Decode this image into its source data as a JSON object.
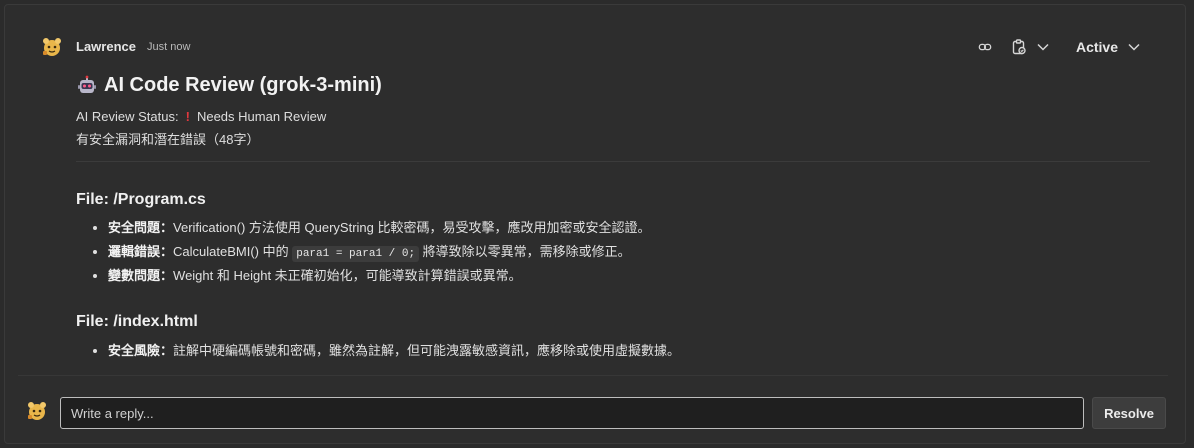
{
  "comment": {
    "author": "Lawrence",
    "time": "Just now",
    "status_dropdown": "Active",
    "title": "AI Code Review (grok-3-mini)",
    "status_label": "AI Review Status:",
    "status_value": "Needs Human Review",
    "summary": "有安全漏洞和潛在錯誤（48字）",
    "sections": [
      {
        "file": "File: /Program.cs",
        "items": [
          {
            "label": "安全問題",
            "sep": "：",
            "text": "Verification() 方法使用 QueryString 比較密碼，易受攻擊，應改用加密或安全認證。"
          },
          {
            "label": "邏輯錯誤",
            "sep": "：",
            "pre": "CalculateBMI() 中的 ",
            "code": "para1 = para1 / 0;",
            "post": " 將導致除以零異常，需移除或修正。"
          },
          {
            "label": "變數問題",
            "sep": "：",
            "text": "Weight 和 Height 未正確初始化，可能導致計算錯誤或異常。"
          }
        ]
      },
      {
        "file": "File: /index.html",
        "items": [
          {
            "label": "安全風險",
            "sep": "：",
            "text": "註解中硬編碼帳號和密碼，雖然為註解，但可能洩露敏感資訊，應移除或使用虛擬數據。"
          }
        ]
      }
    ]
  },
  "reply": {
    "placeholder": "Write a reply...",
    "resolve_label": "Resolve"
  },
  "icons": {
    "link": "link-icon",
    "clipboard": "clipboard-icon",
    "chevron": "chevron-down-icon",
    "robot": "robot-icon",
    "avatar": "avatar-icon"
  },
  "colors": {
    "background": "#2d2d2d",
    "input_border": "#bdbdbd",
    "alert": "#e0383e"
  }
}
